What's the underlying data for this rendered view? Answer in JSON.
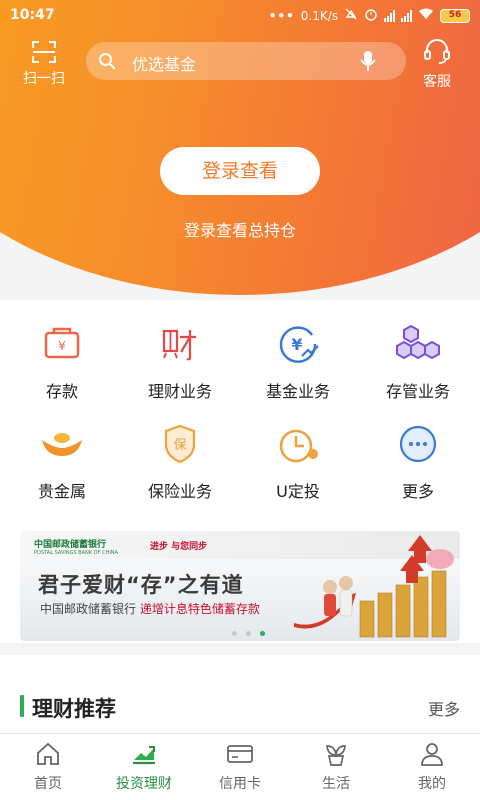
{
  "status_bar": {
    "time": "10:47",
    "network_speed": "0.1K/s",
    "network_type": "HD",
    "battery": "56"
  },
  "header": {
    "scan_label": "扫一扫",
    "search_placeholder": "优选基金",
    "service_label": "客服"
  },
  "hero": {
    "login_button": "登录查看",
    "login_subtitle": "登录查看总持仓"
  },
  "menu": [
    {
      "label": "存款",
      "icon": "deposit-icon"
    },
    {
      "label": "理财业务",
      "icon": "wealth-icon"
    },
    {
      "label": "基金业务",
      "icon": "fund-icon"
    },
    {
      "label": "存管业务",
      "icon": "custody-icon"
    },
    {
      "label": "贵金属",
      "icon": "gold-ingot-icon"
    },
    {
      "label": "保险业务",
      "icon": "insurance-icon"
    },
    {
      "label": "U定投",
      "icon": "clock-icon"
    },
    {
      "label": "更多",
      "icon": "more-icon"
    }
  ],
  "banner": {
    "bank_name": "中国邮政储蓄银行",
    "bank_name_en": "POSTAL SAVINGS BANK OF CHINA",
    "slogan": "进步 与您同步",
    "title": "君子爱财“存”之有道",
    "subtitle_prefix": "中国邮政储蓄银行",
    "subtitle_highlight": "递增计息特色储蓄存款",
    "page_count": 3,
    "active_page": 3
  },
  "recommend": {
    "title": "理财推荐",
    "more": "更多"
  },
  "tabbar": [
    {
      "label": "首页",
      "icon": "home-icon",
      "active": false
    },
    {
      "label": "投资理财",
      "icon": "investment-icon",
      "active": true
    },
    {
      "label": "信用卡",
      "icon": "credit-card-icon",
      "active": false
    },
    {
      "label": "生活",
      "icon": "life-icon",
      "active": false
    },
    {
      "label": "我的",
      "icon": "user-icon",
      "active": false
    }
  ],
  "colors": {
    "accent_green": "#2dae4f",
    "hero_orange": "#f7902a",
    "hero_red": "#ec5a52",
    "login_text": "#f07a2a"
  }
}
